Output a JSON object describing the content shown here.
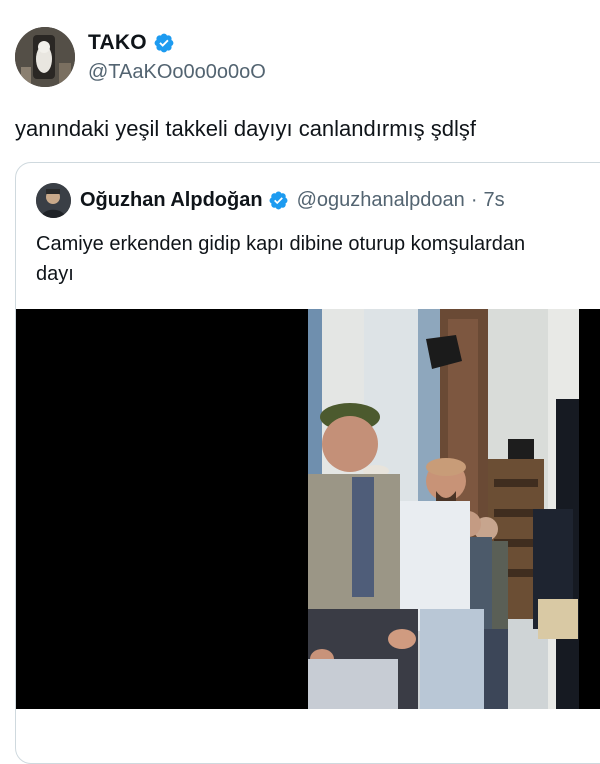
{
  "author": {
    "display_name": "TAKO",
    "handle": "@TAaKOo0o0o0oO",
    "verified": true,
    "avatar_icon": "avatar-image"
  },
  "tweet": {
    "text": "yanındaki yeşil takkeli dayıyı canlandırmış şdlşf"
  },
  "quoted": {
    "display_name": "Oğuzhan Alpdoğan",
    "handle": "@oguzhanalpdoan",
    "separator": "·",
    "time": "7s",
    "text_line1": "Camiye erkenden gidip kapı dibine oturup komşulardan",
    "text_line2": "dayı",
    "verified": true
  },
  "colors": {
    "verified_blue": "#1d9bf0",
    "secondary_text": "#536471",
    "border": "#cfd9de",
    "media_background": "#000000"
  }
}
